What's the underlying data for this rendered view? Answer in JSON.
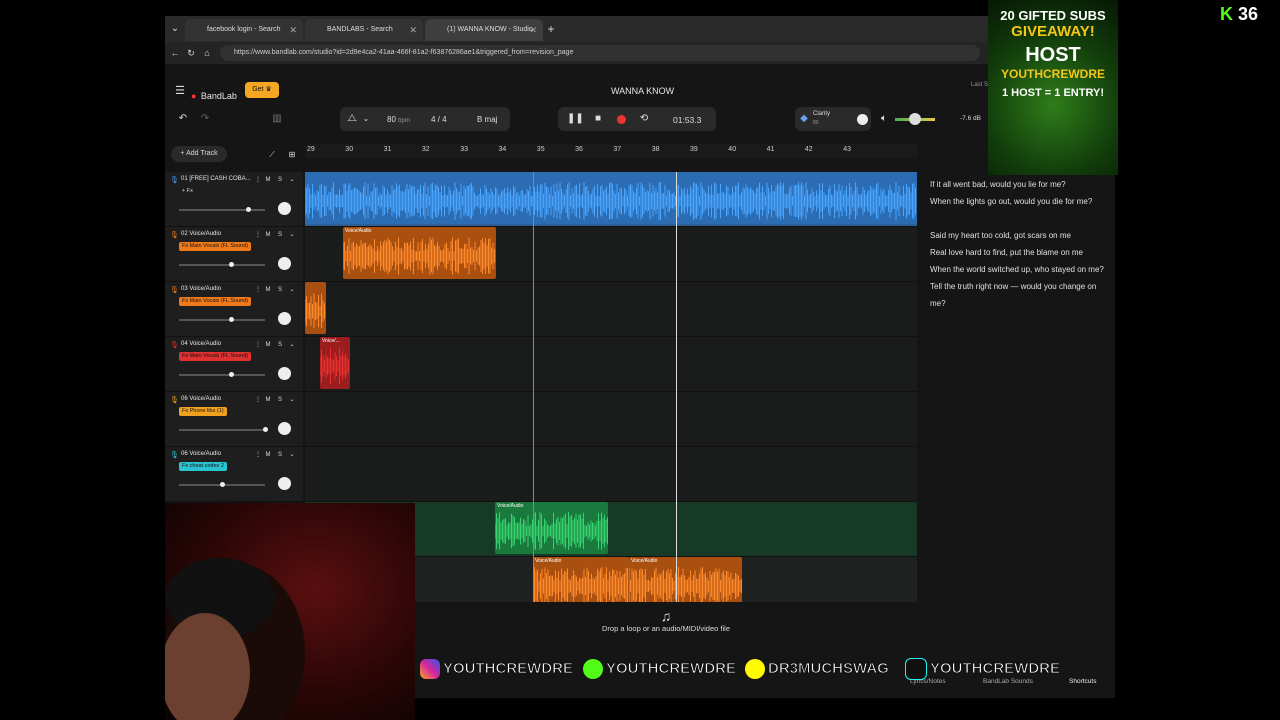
{
  "browser": {
    "tabs": [
      {
        "title": "facebook login - Search"
      },
      {
        "title": "BANDLABS - Search"
      },
      {
        "title": "(1) WANNA KNOW - Studio"
      }
    ],
    "url": "https://www.bandlab.com/studio?id=2d9e4ca2-41aa-466f-81a2-f63876286ae1&triggered_from=revision_page"
  },
  "studio": {
    "brand": "BandLab",
    "get_label": "Get",
    "project_title": "WANNA KNOW",
    "last_saved": "Last S",
    "bpm": "80",
    "bpm_unit": "bpm",
    "time_signature": "4 / 4",
    "key": "B maj",
    "time_display": "01:53.3",
    "clarity_label": "Clarity",
    "clarity_value": "80",
    "master_db": "-7.6 dB",
    "add_track_label": "Add Track"
  },
  "ruler": [
    "29",
    "30",
    "31",
    "32",
    "33",
    "34",
    "35",
    "36",
    "37",
    "38",
    "39",
    "40",
    "41",
    "42",
    "43"
  ],
  "tracks": [
    {
      "name": "01  [FREE] CASH COBA...",
      "fx": "+ Fx",
      "fx_color": "#1e1e1e",
      "fx_text": "#ddd",
      "volume": 0.8,
      "mute": "M",
      "solo": "S"
    },
    {
      "name": "02  Voice/Audio",
      "fx": "Fx  Main Vocals (FL Sound)",
      "fx_color": "#f07a1a",
      "fx_text": "#111",
      "volume": 0.6,
      "mute": "M",
      "solo": "S"
    },
    {
      "name": "03  Voice/Audio",
      "fx": "Fx  Main Vocals (FL Sound)",
      "fx_color": "#f07a1a",
      "fx_text": "#111",
      "volume": 0.6,
      "mute": "M",
      "solo": "S"
    },
    {
      "name": "04  Voice/Audio",
      "fx": "Fx  Main Vocals (FL Sound)",
      "fx_color": "#e03030",
      "fx_text": "#111",
      "volume": 0.6,
      "mute": "M",
      "solo": "S"
    },
    {
      "name": "06  Voice/Audio",
      "fx": "Fx  Phone libs (1)",
      "fx_color": "#f0a020",
      "fx_text": "#111",
      "volume": 1.0,
      "mute": "M",
      "solo": "S"
    },
    {
      "name": "06  Voice/Audio",
      "fx": "Fx  cheat codes 2",
      "fx_color": "#2ac3d0",
      "fx_text": "#111",
      "volume": 0.5,
      "mute": "M",
      "solo": "S"
    }
  ],
  "clip_label": "Voice/Audio",
  "clip_label_short": "Voice/...",
  "drop_hint": "Drop a loop or an audio/MIDI/video file",
  "lyrics": [
    "If it all went bad, would you lie for me?",
    "When the lights go out, would you die for me?",
    "",
    "Said my heart too cold, got scars on me",
    "Real love hard to find, put the blame on me",
    "When the world switched up, who stayed on me?",
    "Tell the truth right now — would you change on me?"
  ],
  "bottom_tabs": {
    "lyrics": "Lyrics/Notes",
    "sounds": "BandLab Sounds",
    "shortcuts": "Shortcuts"
  },
  "overlay": {
    "promo_line1": "20 GIFTED SUBS",
    "promo_line2": "GIVEAWAY!",
    "promo_line3": "HOST",
    "promo_line4": "YOUTHCREWDRE",
    "promo_line5": "1 HOST = 1 ENTRY!",
    "viewer_count": "36",
    "socials": [
      "YOUTHCREWDRE",
      "YOUTHCREWDRE",
      "DR3MUCHSWAG",
      "YOUTHCREWDRE"
    ]
  },
  "colors": {
    "blue_track": "#3d8fe0",
    "orange_clip": "#e8731c",
    "red_clip": "#d42a2a",
    "green_clip": "#27b45a",
    "kick_green": "#53fc18"
  }
}
